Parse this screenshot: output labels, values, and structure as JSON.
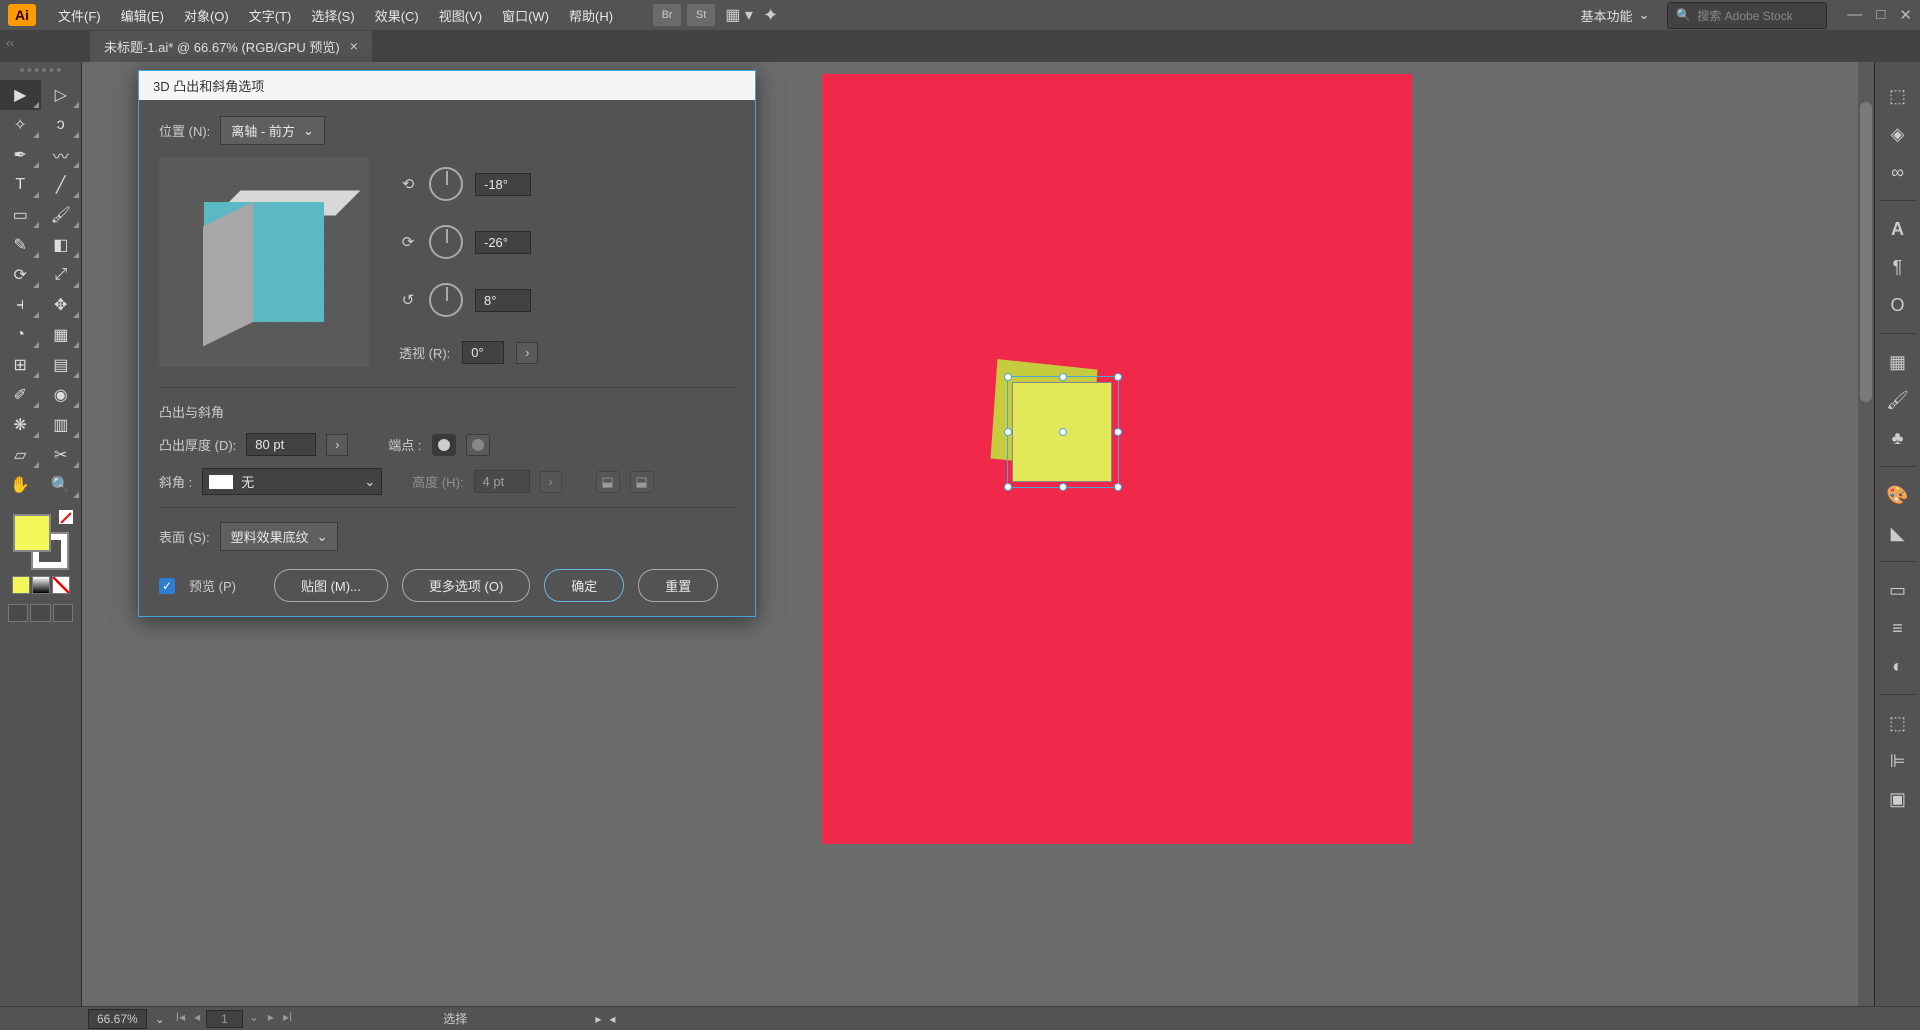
{
  "app": {
    "logo": "Ai"
  },
  "menu": [
    "文件(F)",
    "编辑(E)",
    "对象(O)",
    "文字(T)",
    "选择(S)",
    "效果(C)",
    "视图(V)",
    "窗口(W)",
    "帮助(H)"
  ],
  "topbar": {
    "br_label": "Br",
    "st_label": "St",
    "workspace": "基本功能",
    "search_placeholder": "搜索 Adobe Stock"
  },
  "document": {
    "tab_title": "未标题-1.ai* @ 66.67% (RGB/GPU 预览)"
  },
  "dialog": {
    "title": "3D 凸出和斜角选项",
    "position_label": "位置 (N):",
    "position_value": "离轴 - 前方",
    "rot_x": "-18°",
    "rot_y": "-26°",
    "rot_z": "8°",
    "perspective_label": "透视 (R):",
    "perspective_value": "0°",
    "extrude_section": "凸出与斜角",
    "depth_label": "凸出厚度 (D):",
    "depth_value": "80 pt",
    "cap_label": "端点 :",
    "bevel_label": "斜角 :",
    "bevel_value": "无",
    "height_label": "高度 (H):",
    "height_value": "4 pt",
    "surface_label": "表面 (S):",
    "surface_value": "塑料效果底纹",
    "preview_label": "预览 (P)",
    "map_btn": "贴图 (M)...",
    "more_btn": "更多选项 (O)",
    "ok_btn": "确定",
    "reset_btn": "重置"
  },
  "status": {
    "zoom": "66.67%",
    "artboard_num": "1",
    "label": "选择"
  }
}
